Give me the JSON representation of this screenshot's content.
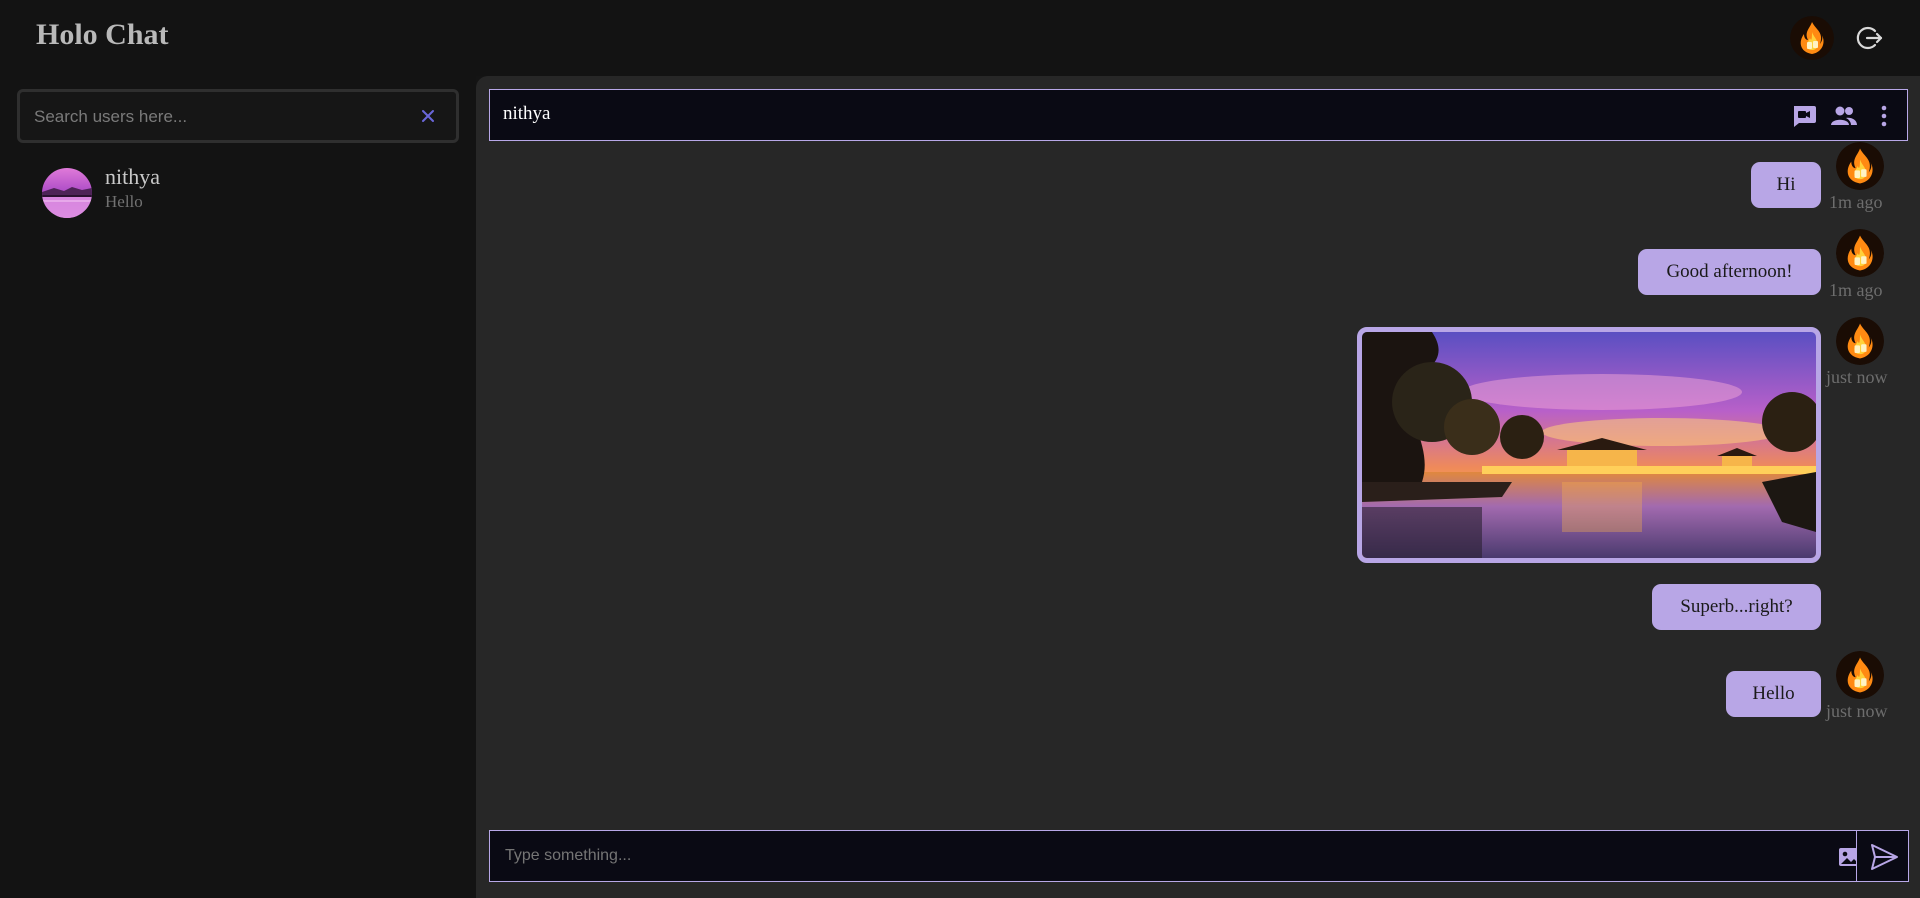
{
  "app": {
    "title": "Holo Chat"
  },
  "colors": {
    "accent": "#b8a6e6",
    "background": "#141414",
    "panel": "#272727",
    "header_bg": "#0a0a14"
  },
  "header": {
    "avatar_icon": "fire-avatar-icon",
    "logout_icon": "logout-icon"
  },
  "search": {
    "placeholder": "Search users here...",
    "clear_icon": "close-icon"
  },
  "users": [
    {
      "name": "nithya",
      "last_message": "Hello"
    }
  ],
  "chat": {
    "contact_name": "nithya",
    "actions": [
      "video-call-icon",
      "group-icon",
      "more-vert-icon"
    ],
    "messages": [
      {
        "type": "text",
        "text": "Hi",
        "time": "1m ago"
      },
      {
        "type": "text",
        "text": "Good afternoon!",
        "time": "1m ago"
      },
      {
        "type": "image",
        "text": "",
        "time": "just now"
      },
      {
        "type": "text",
        "text": "Superb...right?",
        "time": ""
      },
      {
        "type": "text",
        "text": "Hello",
        "time": "just now"
      }
    ]
  },
  "composer": {
    "placeholder": "Type something...",
    "attach_icon": "image-icon",
    "send_icon": "send-icon"
  }
}
